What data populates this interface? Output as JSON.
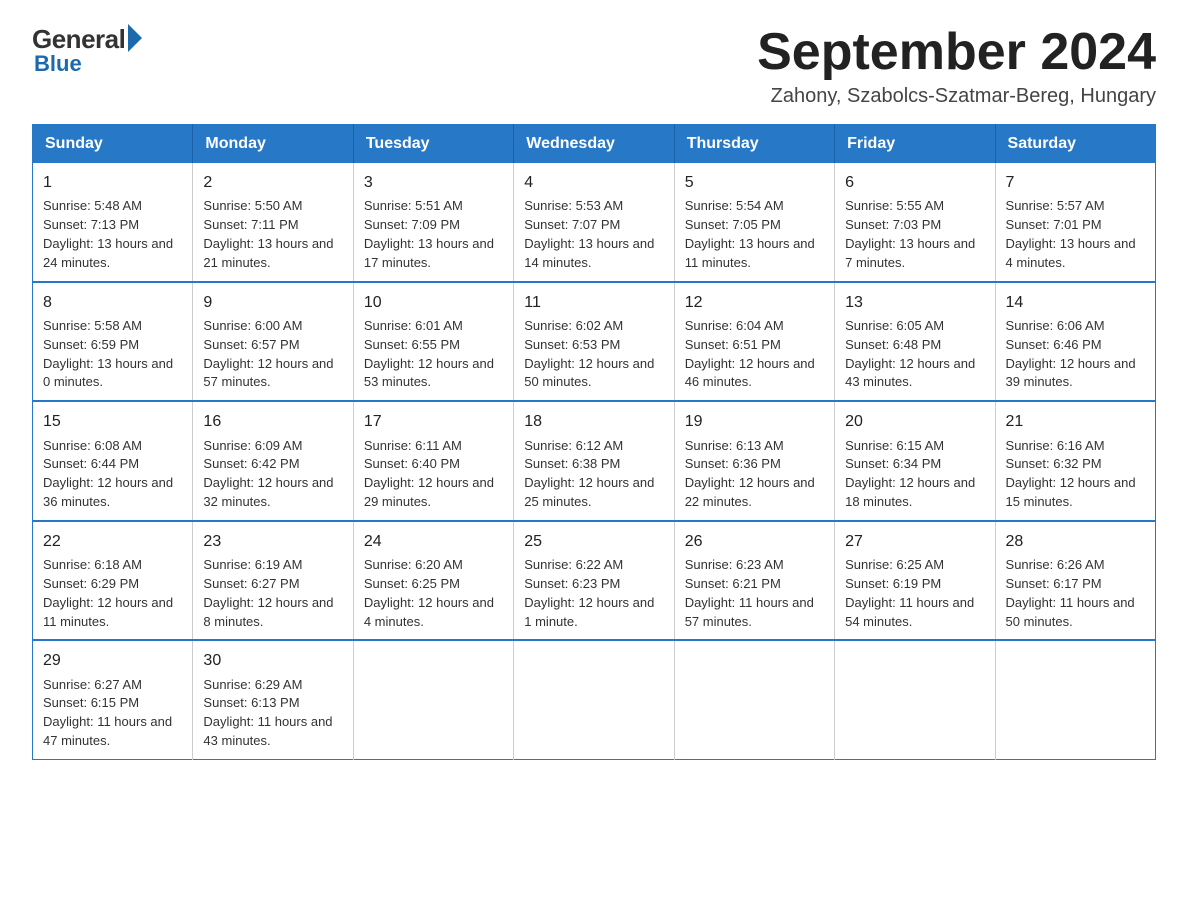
{
  "logo": {
    "general": "General",
    "blue": "Blue"
  },
  "title": {
    "month_year": "September 2024",
    "location": "Zahony, Szabolcs-Szatmar-Bereg, Hungary"
  },
  "headers": [
    "Sunday",
    "Monday",
    "Tuesday",
    "Wednesday",
    "Thursday",
    "Friday",
    "Saturday"
  ],
  "weeks": [
    [
      {
        "day": "1",
        "sunrise": "Sunrise: 5:48 AM",
        "sunset": "Sunset: 7:13 PM",
        "daylight": "Daylight: 13 hours and 24 minutes."
      },
      {
        "day": "2",
        "sunrise": "Sunrise: 5:50 AM",
        "sunset": "Sunset: 7:11 PM",
        "daylight": "Daylight: 13 hours and 21 minutes."
      },
      {
        "day": "3",
        "sunrise": "Sunrise: 5:51 AM",
        "sunset": "Sunset: 7:09 PM",
        "daylight": "Daylight: 13 hours and 17 minutes."
      },
      {
        "day": "4",
        "sunrise": "Sunrise: 5:53 AM",
        "sunset": "Sunset: 7:07 PM",
        "daylight": "Daylight: 13 hours and 14 minutes."
      },
      {
        "day": "5",
        "sunrise": "Sunrise: 5:54 AM",
        "sunset": "Sunset: 7:05 PM",
        "daylight": "Daylight: 13 hours and 11 minutes."
      },
      {
        "day": "6",
        "sunrise": "Sunrise: 5:55 AM",
        "sunset": "Sunset: 7:03 PM",
        "daylight": "Daylight: 13 hours and 7 minutes."
      },
      {
        "day": "7",
        "sunrise": "Sunrise: 5:57 AM",
        "sunset": "Sunset: 7:01 PM",
        "daylight": "Daylight: 13 hours and 4 minutes."
      }
    ],
    [
      {
        "day": "8",
        "sunrise": "Sunrise: 5:58 AM",
        "sunset": "Sunset: 6:59 PM",
        "daylight": "Daylight: 13 hours and 0 minutes."
      },
      {
        "day": "9",
        "sunrise": "Sunrise: 6:00 AM",
        "sunset": "Sunset: 6:57 PM",
        "daylight": "Daylight: 12 hours and 57 minutes."
      },
      {
        "day": "10",
        "sunrise": "Sunrise: 6:01 AM",
        "sunset": "Sunset: 6:55 PM",
        "daylight": "Daylight: 12 hours and 53 minutes."
      },
      {
        "day": "11",
        "sunrise": "Sunrise: 6:02 AM",
        "sunset": "Sunset: 6:53 PM",
        "daylight": "Daylight: 12 hours and 50 minutes."
      },
      {
        "day": "12",
        "sunrise": "Sunrise: 6:04 AM",
        "sunset": "Sunset: 6:51 PM",
        "daylight": "Daylight: 12 hours and 46 minutes."
      },
      {
        "day": "13",
        "sunrise": "Sunrise: 6:05 AM",
        "sunset": "Sunset: 6:48 PM",
        "daylight": "Daylight: 12 hours and 43 minutes."
      },
      {
        "day": "14",
        "sunrise": "Sunrise: 6:06 AM",
        "sunset": "Sunset: 6:46 PM",
        "daylight": "Daylight: 12 hours and 39 minutes."
      }
    ],
    [
      {
        "day": "15",
        "sunrise": "Sunrise: 6:08 AM",
        "sunset": "Sunset: 6:44 PM",
        "daylight": "Daylight: 12 hours and 36 minutes."
      },
      {
        "day": "16",
        "sunrise": "Sunrise: 6:09 AM",
        "sunset": "Sunset: 6:42 PM",
        "daylight": "Daylight: 12 hours and 32 minutes."
      },
      {
        "day": "17",
        "sunrise": "Sunrise: 6:11 AM",
        "sunset": "Sunset: 6:40 PM",
        "daylight": "Daylight: 12 hours and 29 minutes."
      },
      {
        "day": "18",
        "sunrise": "Sunrise: 6:12 AM",
        "sunset": "Sunset: 6:38 PM",
        "daylight": "Daylight: 12 hours and 25 minutes."
      },
      {
        "day": "19",
        "sunrise": "Sunrise: 6:13 AM",
        "sunset": "Sunset: 6:36 PM",
        "daylight": "Daylight: 12 hours and 22 minutes."
      },
      {
        "day": "20",
        "sunrise": "Sunrise: 6:15 AM",
        "sunset": "Sunset: 6:34 PM",
        "daylight": "Daylight: 12 hours and 18 minutes."
      },
      {
        "day": "21",
        "sunrise": "Sunrise: 6:16 AM",
        "sunset": "Sunset: 6:32 PM",
        "daylight": "Daylight: 12 hours and 15 minutes."
      }
    ],
    [
      {
        "day": "22",
        "sunrise": "Sunrise: 6:18 AM",
        "sunset": "Sunset: 6:29 PM",
        "daylight": "Daylight: 12 hours and 11 minutes."
      },
      {
        "day": "23",
        "sunrise": "Sunrise: 6:19 AM",
        "sunset": "Sunset: 6:27 PM",
        "daylight": "Daylight: 12 hours and 8 minutes."
      },
      {
        "day": "24",
        "sunrise": "Sunrise: 6:20 AM",
        "sunset": "Sunset: 6:25 PM",
        "daylight": "Daylight: 12 hours and 4 minutes."
      },
      {
        "day": "25",
        "sunrise": "Sunrise: 6:22 AM",
        "sunset": "Sunset: 6:23 PM",
        "daylight": "Daylight: 12 hours and 1 minute."
      },
      {
        "day": "26",
        "sunrise": "Sunrise: 6:23 AM",
        "sunset": "Sunset: 6:21 PM",
        "daylight": "Daylight: 11 hours and 57 minutes."
      },
      {
        "day": "27",
        "sunrise": "Sunrise: 6:25 AM",
        "sunset": "Sunset: 6:19 PM",
        "daylight": "Daylight: 11 hours and 54 minutes."
      },
      {
        "day": "28",
        "sunrise": "Sunrise: 6:26 AM",
        "sunset": "Sunset: 6:17 PM",
        "daylight": "Daylight: 11 hours and 50 minutes."
      }
    ],
    [
      {
        "day": "29",
        "sunrise": "Sunrise: 6:27 AM",
        "sunset": "Sunset: 6:15 PM",
        "daylight": "Daylight: 11 hours and 47 minutes."
      },
      {
        "day": "30",
        "sunrise": "Sunrise: 6:29 AM",
        "sunset": "Sunset: 6:13 PM",
        "daylight": "Daylight: 11 hours and 43 minutes."
      },
      null,
      null,
      null,
      null,
      null
    ]
  ]
}
